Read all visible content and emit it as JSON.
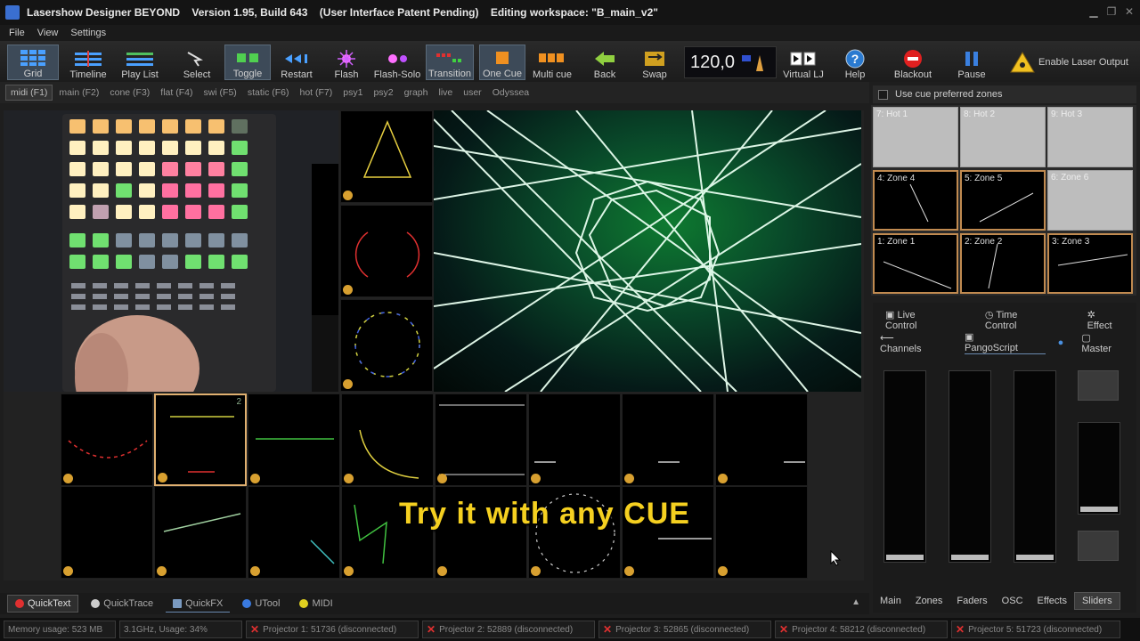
{
  "window": {
    "title": "Lasershow Designer BEYOND    Version 1.95, Build 643    (User Interface Patent Pending)    Editing workspace: \"B_main_v2\"",
    "controls": [
      "▁",
      "❐",
      "✕"
    ]
  },
  "menu": [
    "File",
    "View",
    "Settings"
  ],
  "toolbar": {
    "buttons": [
      {
        "label": "Grid",
        "icon": "grid-icon"
      },
      {
        "label": "Timeline",
        "icon": "timeline-icon"
      },
      {
        "label": "Play List",
        "icon": "playlist-icon"
      },
      {
        "label": "Select",
        "icon": "select-icon"
      },
      {
        "label": "Toggle",
        "icon": "toggle-icon"
      },
      {
        "label": "Restart",
        "icon": "restart-icon"
      },
      {
        "label": "Flash",
        "icon": "flash-icon"
      },
      {
        "label": "Flash-Solo",
        "icon": "flash-solo-icon"
      },
      {
        "label": "Transition",
        "icon": "transition-icon"
      },
      {
        "label": "One Cue",
        "icon": "one-cue-icon"
      },
      {
        "label": "Multi cue",
        "icon": "multi-cue-icon"
      },
      {
        "label": "Back",
        "icon": "back-arrow-icon"
      },
      {
        "label": "Swap",
        "icon": "swap-icon"
      },
      {
        "label": "Virtual LJ",
        "icon": "virtual-lj-icon"
      },
      {
        "label": "Help",
        "icon": "help-icon"
      },
      {
        "label": "Blackout",
        "icon": "blackout-icon"
      },
      {
        "label": "Pause",
        "icon": "pause-icon"
      },
      {
        "label": "Enable Laser Output",
        "icon": "laser-warning-icon"
      }
    ],
    "bpm": "120,0"
  },
  "page_tabs": [
    "midi (F1)",
    "main (F2)",
    "cone (F3)",
    "flat (F4)",
    "swi (F5)",
    "static (F6)",
    "hot (F7)",
    "psy1",
    "psy2",
    "graph",
    "live",
    "user",
    "Odyssea"
  ],
  "grid": {
    "selected_cell_number": "2",
    "overlay_text": "Try it with any CUE"
  },
  "zones": {
    "header_label": "Use cue preferred zones",
    "items": [
      "7: Hot 1",
      "8: Hot 2",
      "9: Hot 3",
      "4: Zone 4",
      "5: Zone 5",
      "6: Zone 6",
      "1: Zone 1",
      "2: Zone 2",
      "3: Zone 3"
    ]
  },
  "control_panel": {
    "tabs_row1": [
      "Live Control",
      "Time Control",
      "Effect"
    ],
    "tabs_row2": [
      "Channels",
      "PangoScript",
      "Master"
    ],
    "bottom_tabs": [
      "Main",
      "Zones",
      "Faders",
      "OSC",
      "Effects",
      "Sliders"
    ],
    "selected_bottom_tab": "Sliders"
  },
  "bottom_tabs": [
    "QuickText",
    "QuickTrace",
    "QuickFX",
    "UTool",
    "MIDI"
  ],
  "status": {
    "memory": "Memory usage: 523 MB",
    "cpu": "3.1GHz, Usage: 34%",
    "projectors": [
      "Projector 1: 51736 (disconnected)",
      "Projector 2: 52889 (disconnected)",
      "Projector 3: 52865 (disconnected)",
      "Projector 4: 58212 (disconnected)",
      "Projector 5: 51723 (disconnected)"
    ]
  },
  "colors": {
    "accent": "#e0b070",
    "overlay_text": "#f5d020",
    "disconnected": "#e03030"
  }
}
